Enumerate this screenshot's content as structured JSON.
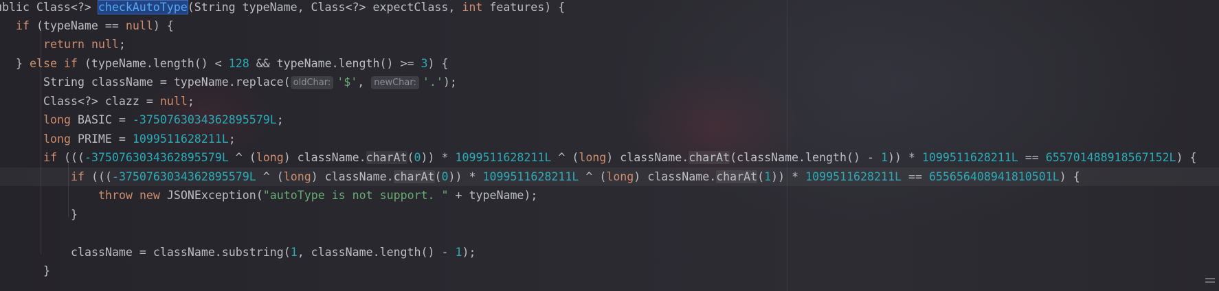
{
  "editor": {
    "lines": {
      "l1": {
        "a": "ublic Class<?> ",
        "b": "checkAutoType",
        "c": "(String typeName, Class<?> expectClass, ",
        "d": "int",
        "e": " features) {"
      },
      "l2": {
        "a": "if",
        "b": " (typeName == ",
        "c": "null",
        "d": ") {"
      },
      "l3": {
        "a": "return",
        "b": " ",
        "c": "null",
        "d": ";"
      },
      "l4": {
        "a": "} ",
        "b": "else if",
        "c": " (typeName.length() < ",
        "d": "128",
        "e": " && typeName.length() >= ",
        "f": "3",
        "g": ") {"
      },
      "l5": {
        "a": "String className = typeName.replace(",
        "h1": "oldChar:",
        "b": "'$'",
        "c": ", ",
        "h2": "newChar:",
        "d": "'.'",
        "e": ");"
      },
      "l6": {
        "a": "Class<?> clazz = ",
        "b": "null",
        "c": ";"
      },
      "l7": {
        "a": "long",
        "b": " BASIC = ",
        "c": "-3750763034362895579L",
        "d": ";"
      },
      "l8": {
        "a": "long",
        "b": " PRIME = ",
        "c": "1099511628211L",
        "d": ";"
      },
      "l9": {
        "a": "if",
        "b": " (((",
        "c": "-3750763034362895579L",
        "d": " ^ (",
        "e": "long",
        "f": ") className.",
        "g": "charAt",
        "h": "(",
        "i": "0",
        "j": ")) * ",
        "k": "1099511628211L",
        "l": " ^ (",
        "m": "long",
        "n": ") className.",
        "o": "charAt",
        "p": "(className.length() - ",
        "q": "1",
        "r": ")) * ",
        "s": "1099511628211L",
        "t": " == ",
        "u": "655701488918567152L",
        "v": ") {"
      },
      "l10": {
        "a": "if",
        "b": " (((",
        "c": "-3750763034362895579L",
        "d": " ^ (",
        "e": "long",
        "f": ") className.",
        "g": "charAt",
        "h": "(",
        "i": "0",
        "j": ")) * ",
        "k": "1099511628211L",
        "l": " ^ (",
        "m": "long",
        "n": ") className.",
        "o": "charAt",
        "p": "(",
        "q": "1",
        "r": ")) * ",
        "s": "1099511628211L",
        "t": " == ",
        "u": "655656408941810501L",
        "v": ") {"
      },
      "l11": {
        "a": "throw new",
        "b": " JSONException(",
        "c": "\"autoType is not support. \"",
        "d": " + typeName);"
      },
      "l12": {
        "a": "}"
      },
      "l14": {
        "a": "className = className.substring(",
        "b": "1",
        "c": ", className.length() - ",
        "d": "1",
        "e": ");"
      },
      "l15": {
        "a": "}"
      }
    }
  },
  "colors": {
    "keyword": "#cf8e6d",
    "number": "#2aacb8",
    "string": "#6aab73",
    "function": "#56a8f5",
    "text": "#bcbec4"
  },
  "icons": {
    "scroll": "scroll-marker-icon"
  }
}
